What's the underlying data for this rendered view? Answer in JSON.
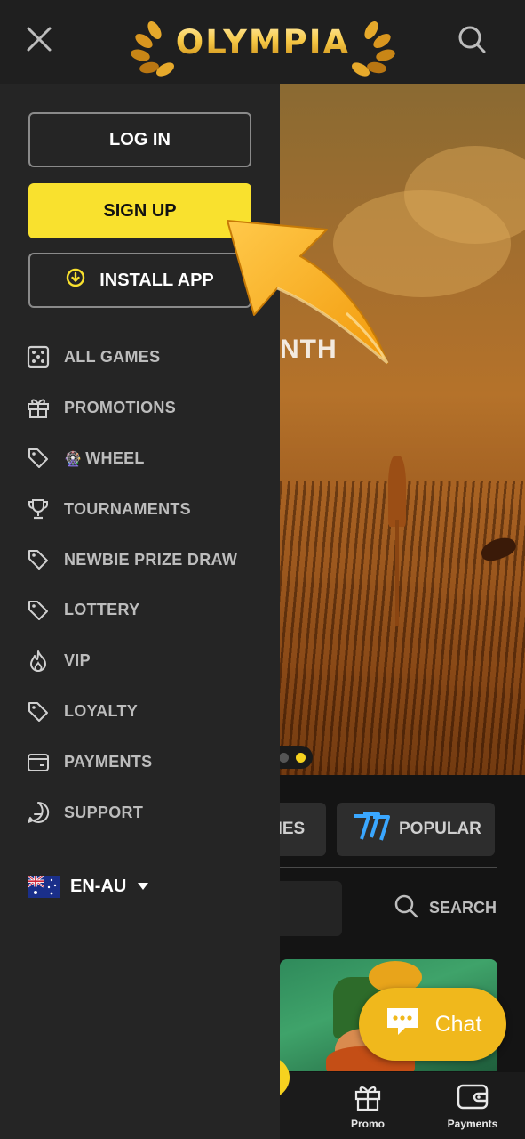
{
  "header": {
    "logo_text": "OLYMPIA",
    "close_icon": "close-icon",
    "search_icon": "search-icon"
  },
  "sidebar": {
    "login_label": "LOG IN",
    "signup_label": "SIGN UP",
    "install_label": "INSTALL APP",
    "menu": [
      {
        "label": "ALL GAMES",
        "icon": "dice-icon"
      },
      {
        "label": "PROMOTIONS",
        "icon": "gift-icon"
      },
      {
        "label": "WHEEL",
        "icon": "tag-icon",
        "prefix_glyph": "🎡"
      },
      {
        "label": "TOURNAMENTS",
        "icon": "trophy-icon"
      },
      {
        "label": "NEWBIE PRIZE DRAW",
        "icon": "tag-icon"
      },
      {
        "label": "LOTTERY",
        "icon": "tag-icon"
      },
      {
        "label": "VIP",
        "icon": "flame-icon"
      },
      {
        "label": "LOYALTY",
        "icon": "tag-icon"
      },
      {
        "label": "PAYMENTS",
        "icon": "wallet-icon"
      },
      {
        "label": "SUPPORT",
        "icon": "chat-bubble-icon"
      }
    ],
    "language": "EN-AU"
  },
  "background": {
    "hero_partial_text": "NTH",
    "tab_games_partial": "MES",
    "tab_popular": "POPULAR",
    "search_label": "SEARCH",
    "chat_label": "Chat",
    "bottom_nav": [
      {
        "label": "Promo",
        "icon": "gift-icon"
      },
      {
        "label": "Payments",
        "icon": "wallet-icon"
      }
    ]
  },
  "colors": {
    "accent_yellow": "#f9e12e",
    "chat_yellow": "#f0b81c",
    "sidebar_bg": "#252525"
  }
}
